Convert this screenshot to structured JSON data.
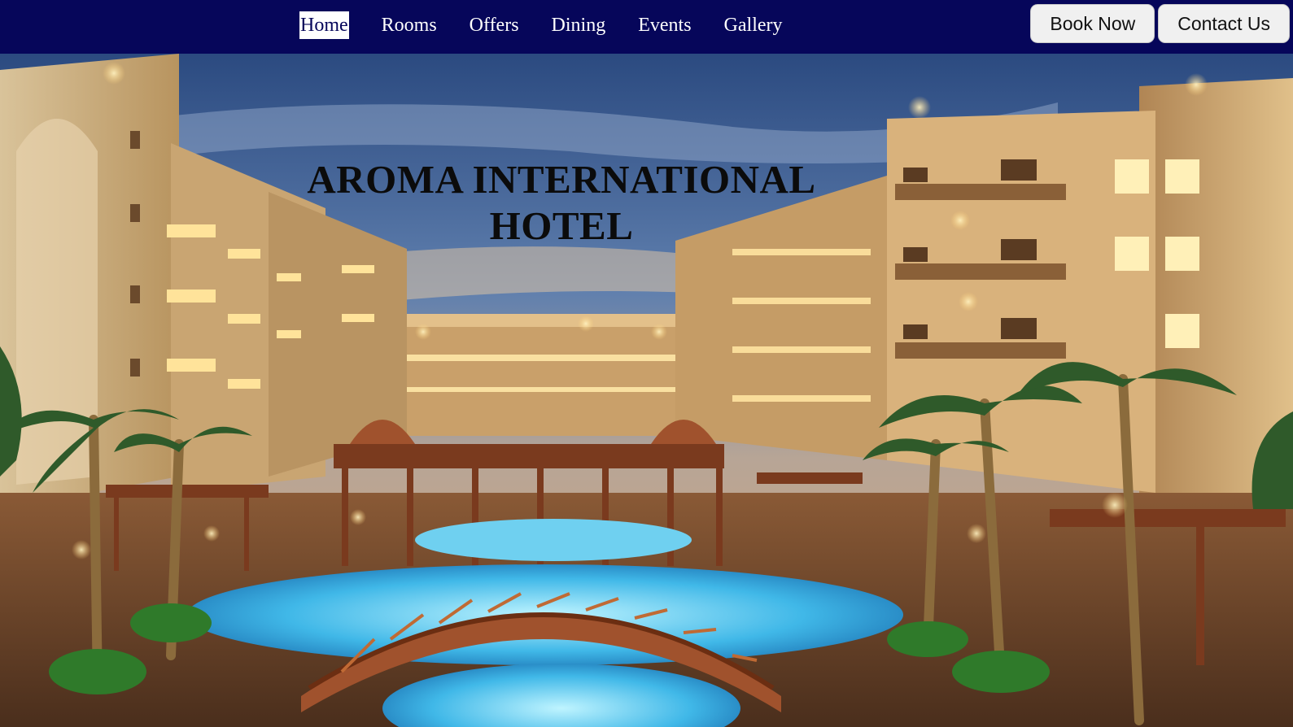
{
  "nav": {
    "links": [
      {
        "label": "Home",
        "active": true
      },
      {
        "label": "Rooms"
      },
      {
        "label": "Offers"
      },
      {
        "label": "Dining"
      },
      {
        "label": "Events"
      },
      {
        "label": "Gallery"
      }
    ],
    "book_now_label": "Book Now",
    "contact_us_label": "Contact Us"
  },
  "hero": {
    "title": "AROMA INTERNATIONAL HOTEL",
    "image_description_icon": "hotel-photo"
  },
  "colors": {
    "navbar_bg": "#06065a",
    "nav_text": "#ffffff",
    "button_bg": "#f0f0f0",
    "title_text": "#0b0b0b"
  }
}
